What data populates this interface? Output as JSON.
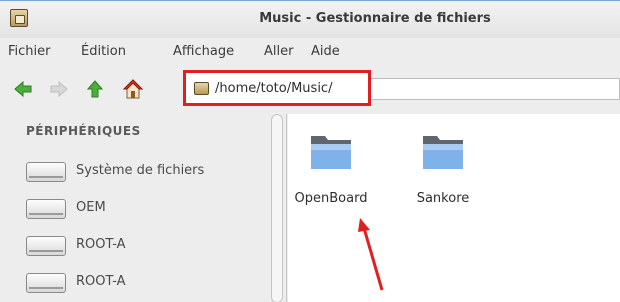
{
  "window": {
    "title": "Music - Gestionnaire de fichiers"
  },
  "menubar": {
    "items": [
      "Fichier",
      "Édition",
      "Affichage",
      "Aller",
      "Aide"
    ]
  },
  "toolbar": {
    "back_icon": "arrow-left-icon",
    "forward_icon": "arrow-right-icon",
    "up_icon": "arrow-up-icon",
    "home_icon": "home-icon",
    "location_path": "/home/toto/Music/"
  },
  "sidebar": {
    "heading": "PÉRIPHÉRIQUES",
    "items": [
      {
        "label": "Système de fichiers",
        "icon": "drive-icon"
      },
      {
        "label": "OEM",
        "icon": "drive-icon"
      },
      {
        "label": "ROOT-A",
        "icon": "drive-icon"
      },
      {
        "label": "ROOT-A",
        "icon": "drive-icon"
      }
    ]
  },
  "content": {
    "folders": [
      {
        "name": "OpenBoard",
        "icon": "folder-icon"
      },
      {
        "name": "Sankore",
        "icon": "folder-icon"
      }
    ]
  },
  "colors": {
    "highlight_border": "#e02020",
    "arrow": "#e02020",
    "nav_green": "#3aa53a",
    "folder_blue": "#6fa3db"
  }
}
